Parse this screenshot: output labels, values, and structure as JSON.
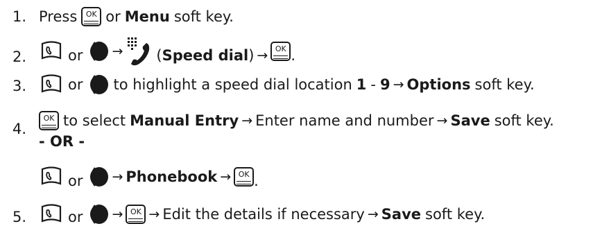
{
  "ok_key_label": "OK",
  "arrow": "→",
  "steps": {
    "s1": {
      "num": "1.",
      "t1": "Press",
      "t2": "or",
      "menu": "Menu",
      "t3": "soft key."
    },
    "s2": {
      "num": "2.",
      "or": "or",
      "open_paren": "(",
      "speed_dial": "Speed dial",
      "close_paren": ")",
      "period": "."
    },
    "s3": {
      "num": "3.",
      "or": "or",
      "t1": "to highlight a speed dial location",
      "n1": "1",
      "dash": "-",
      "n9": "9",
      "options": "Options",
      "t2": "soft key."
    },
    "s4": {
      "num": "4.",
      "t1": "to select",
      "manual_entry": "Manual Entry",
      "t2": "Enter name and number",
      "save": "Save",
      "t3": "soft key.",
      "alt": "- OR -"
    },
    "s4b": {
      "or": "or",
      "phonebook": "Phonebook",
      "period": "."
    },
    "s5": {
      "num": "5.",
      "or": "or",
      "t1": "Edit the details if necessary",
      "save": "Save",
      "t2": "soft key."
    }
  },
  "icons": {
    "nav_key": "nav-key-icon",
    "scroll_key": "scroll-key-icon",
    "speed_dial": "speed-dial-icon",
    "ok_key": "ok-key-icon"
  }
}
